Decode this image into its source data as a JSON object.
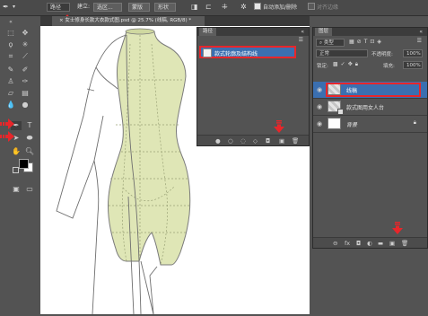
{
  "options_bar": {
    "path_mode": "路径",
    "make_label": "建立:",
    "selection_button": "选区...",
    "mask_button": "蒙版",
    "shape_button": "形状",
    "auto_add_delete": "自动添加/删除",
    "align_edges": "对齐边缘"
  },
  "document": {
    "tab_title": "× 女士修身长款大衣款式图.psd @ 25.7% (线稿, RGB/8) *"
  },
  "paths_panel": {
    "tab_label": "路径",
    "path_item": "款式轮廓及结构线"
  },
  "layers_panel": {
    "tab_label": "图层",
    "kind_label": "类型",
    "blend_mode": "正常",
    "opacity_label": "不透明度:",
    "opacity_value": "100%",
    "lock_label": "锁定:",
    "fill_label": "填充:",
    "fill_value": "100%",
    "layers": [
      {
        "name": "线稿"
      },
      {
        "name": "款式图用女人台"
      },
      {
        "name": "背景"
      }
    ],
    "footer_link": "fx"
  },
  "colors": {
    "highlight_red": "#e8262a",
    "form_fill": "#dfe6b6",
    "selected_blue": "#3b6fb0"
  }
}
